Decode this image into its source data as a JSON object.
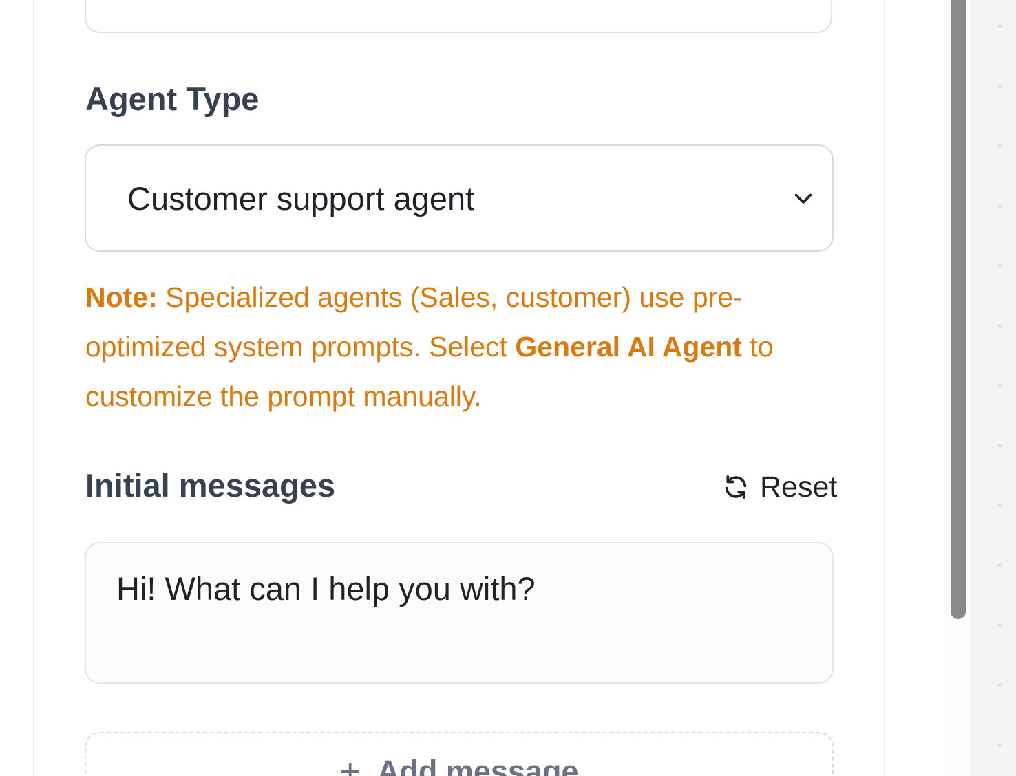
{
  "agent_type": {
    "label": "Agent Type",
    "selected": "Customer support agent"
  },
  "note": {
    "prefix": "Note:",
    "text_1": " Specialized agents (Sales, customer) use pre-optimized system prompts. Select ",
    "highlight": "General AI Agent",
    "text_2": " to customize the prompt manually."
  },
  "initial_messages": {
    "label": "Initial messages",
    "reset_label": "Reset",
    "messages": [
      "Hi! What can I help you with?"
    ],
    "add_label": "Add message"
  },
  "icons": {
    "select": "chevron-down-icon",
    "reset": "refresh-icon",
    "add": "plus-icon"
  },
  "colors": {
    "note": "#d97a10",
    "label": "#374151",
    "text": "#1f2328",
    "scrollbar": "#8a8a8a"
  }
}
